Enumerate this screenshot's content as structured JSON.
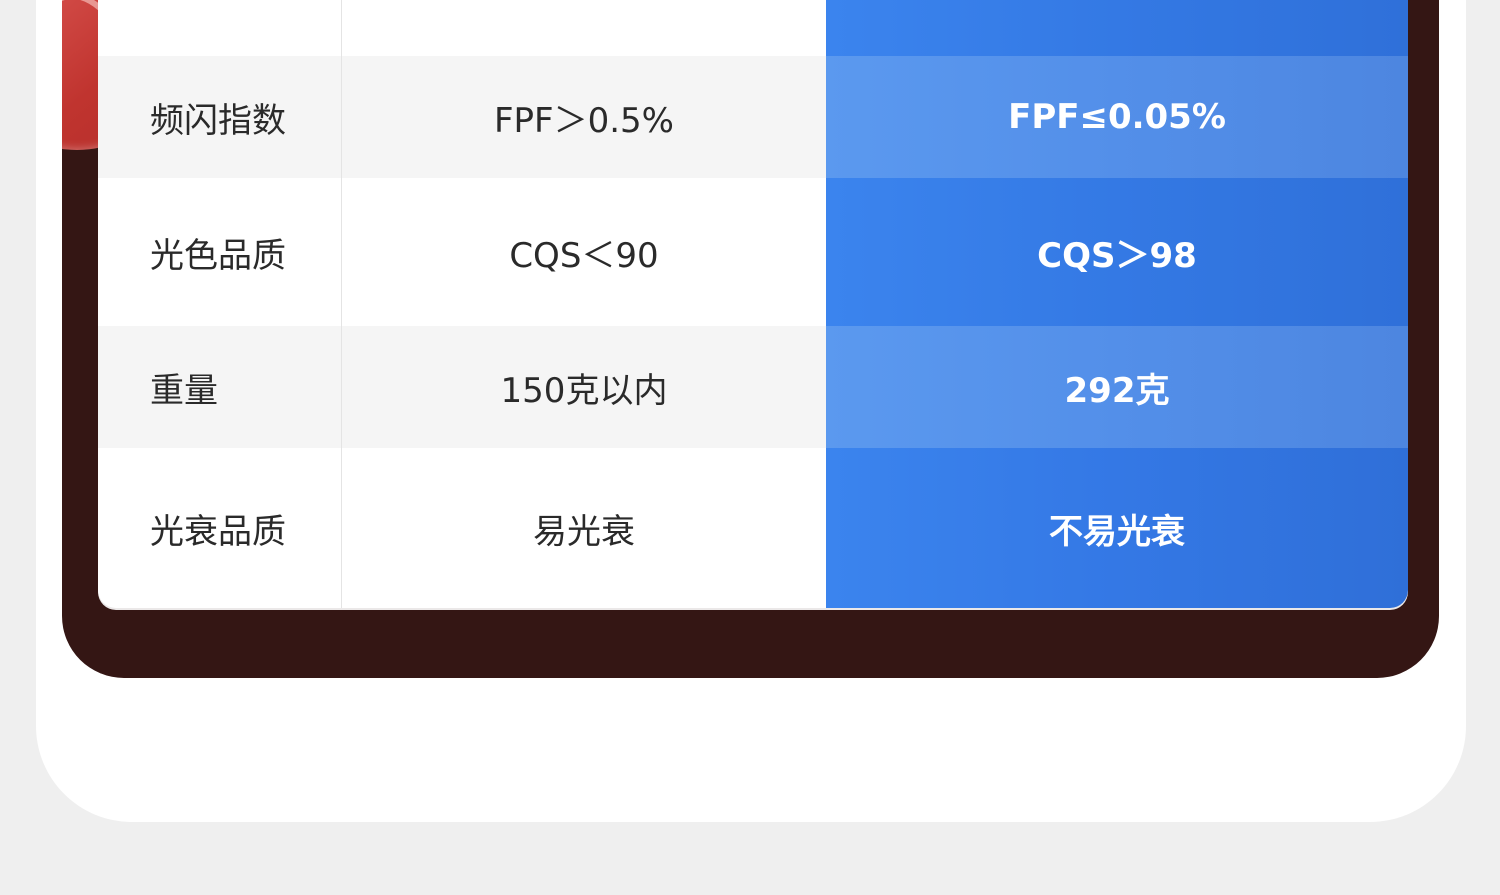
{
  "comparison": {
    "rows": [
      {
        "label": "",
        "other": "",
        "ours": ""
      },
      {
        "label": "频闪指数",
        "other": "FPF＞0.5%",
        "ours": "FPF≤0.05%"
      },
      {
        "label": "光色品质",
        "other": "CQS＜90",
        "ours": "CQS＞98"
      },
      {
        "label": "重量",
        "other": "150克以内",
        "ours": "292克"
      },
      {
        "label": "光衰品质",
        "other": "易光衰",
        "ours": "不易光衰"
      }
    ]
  },
  "colors": {
    "page_background": "#efefef",
    "card_background": "#ffffff",
    "panel_dark": "#341614",
    "highlight_blue": "#3479e4",
    "highlight_blue_light": "#538fe9",
    "accent_red": "#d6504c"
  }
}
